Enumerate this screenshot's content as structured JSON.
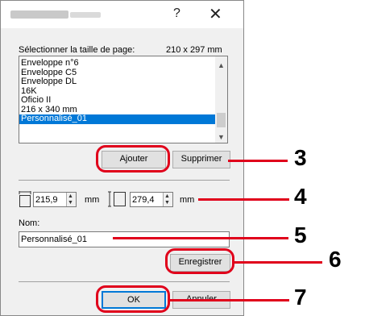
{
  "titlebar": {
    "help": "?",
    "close": "✕"
  },
  "page_size": {
    "label": "Sélectionner la taille de page:",
    "value": "210 x 297 mm"
  },
  "list": {
    "items": [
      "Enveloppe n°6",
      "Enveloppe C5",
      "Enveloppe DL",
      "16K",
      "Oficio II",
      "216 x 340 mm",
      "Personnalisé_01"
    ],
    "selected_index": 6
  },
  "buttons": {
    "add": "Ajouter",
    "delete": "Supprimer",
    "save": "Enregistrer",
    "ok": "OK",
    "cancel": "Annuler"
  },
  "dimensions": {
    "width_value": "215,9",
    "width_unit": "mm",
    "height_value": "279,4",
    "height_unit": "mm"
  },
  "name_field": {
    "label": "Nom:",
    "value": "Personnalisé_01"
  },
  "callouts": [
    "3",
    "4",
    "5",
    "6",
    "7"
  ],
  "colors": {
    "highlight": "#e0001b",
    "selection": "#0078d7"
  }
}
